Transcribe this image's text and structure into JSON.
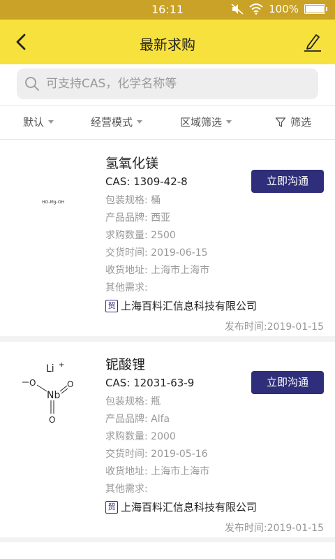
{
  "status_bar": {
    "time": "16:11",
    "battery": "100%"
  },
  "header": {
    "title": "最新求购"
  },
  "search": {
    "placeholder": "可支持CAS，化学名称等"
  },
  "filters": [
    {
      "label": "默认"
    },
    {
      "label": "经营模式"
    },
    {
      "label": "区域筛选"
    },
    {
      "label": "筛选"
    }
  ],
  "listings": [
    {
      "name": "氢氧化镁",
      "cas": "CAS: 1309-42-8",
      "structure_label": "HO-Mg-OH",
      "packaging": "包装规格: 桶",
      "brand": "产品品牌: 西亚",
      "quantity": "求购数量: 2500",
      "delivery": "交货时间: 2019-06-15",
      "address": "收货地址: 上海市上海市",
      "other": "其他需求:",
      "badge": "贸",
      "company": "上海百料汇信息科技有限公司",
      "published": "发布时间:2019-01-15",
      "action": "立即沟通"
    },
    {
      "name": "铌酸锂",
      "cas": "CAS: 12031-63-9",
      "structure_label": {
        "li": "Li",
        "plus": "+",
        "nb": "Nb",
        "o": "O"
      },
      "packaging": "包装规格: 瓶",
      "brand": "产品品牌: Alfa",
      "quantity": "求购数量: 2000",
      "delivery": "交货时间: 2019-05-16",
      "address": "收货地址: 上海市上海市",
      "other": "其他需求:",
      "badge": "贸",
      "company": "上海百料汇信息科技有限公司",
      "published": "发布时间:2019-01-15",
      "action": "立即沟通"
    }
  ],
  "colors": {
    "status": "#C9A227",
    "header": "#F7E13C",
    "button": "#2E2E7A",
    "muted": "#999999"
  },
  "icons": {
    "back": "chevron-left-icon",
    "edit": "pencil-icon",
    "search": "search-icon",
    "filter": "funnel-icon"
  }
}
